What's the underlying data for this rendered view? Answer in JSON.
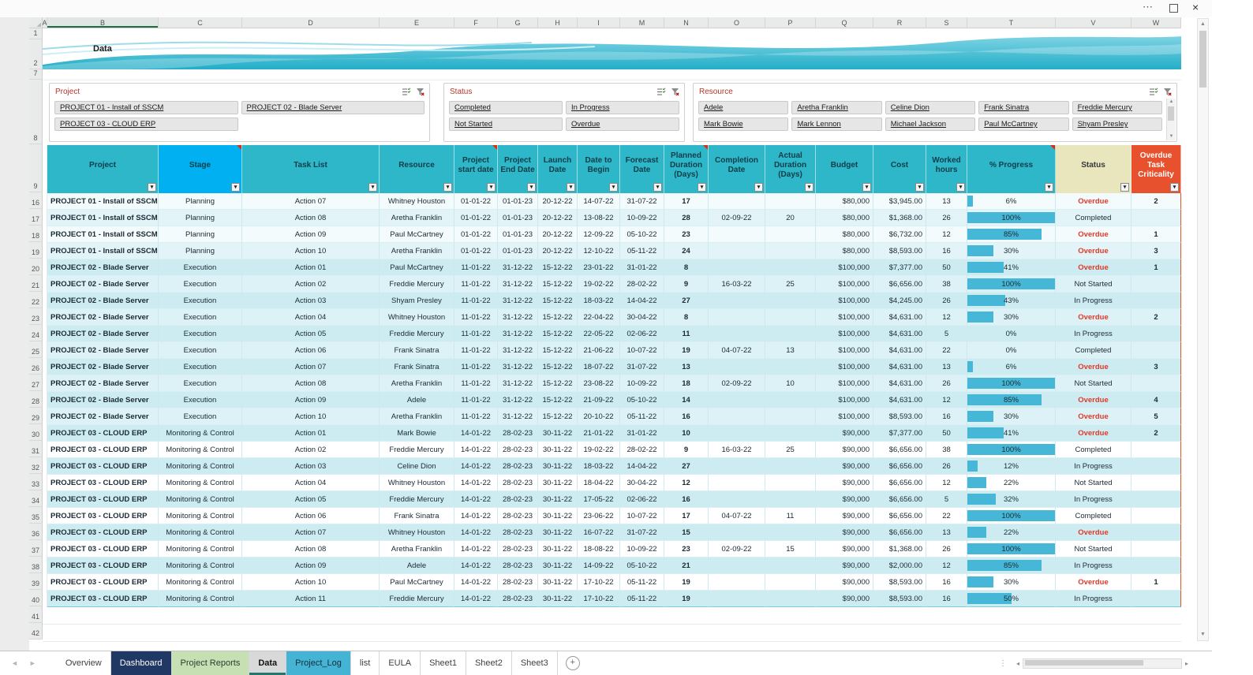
{
  "window": {
    "menu_icon": "⋯",
    "close_icon": "×"
  },
  "icons": {
    "filter_dropdown": "▾",
    "scroll_up": "▲",
    "scroll_down": "▼",
    "left_arrow": "◄",
    "right_arrow": "►",
    "hscroll_left": "◂",
    "hscroll_right": "▸",
    "new_sheet": "+",
    "select_all": "◢",
    "handle": "⋮"
  },
  "banner": {
    "label": "Data"
  },
  "grid": {
    "columns": [
      "A",
      "B",
      "C",
      "D",
      "E",
      "F",
      "G",
      "H",
      "I",
      "M",
      "N",
      "O",
      "P",
      "Q",
      "R",
      "S",
      "T",
      "V",
      "W"
    ],
    "leading_rows": [
      "1",
      "2",
      "7",
      "8",
      "9"
    ],
    "trailing_rows": [
      "41",
      "42"
    ],
    "selected_column": "B"
  },
  "slicers": [
    {
      "title": "Project",
      "columns": 2,
      "items": [
        "PROJECT 01 - Install of SSCM",
        "PROJECT 02 - Blade Server",
        "PROJECT 03 - CLOUD ERP"
      ]
    },
    {
      "title": "Status",
      "columns": 2,
      "items": [
        "Completed",
        "In Progress",
        "Not Started",
        "Overdue"
      ]
    },
    {
      "title": "Resource",
      "columns": 5,
      "scrollbar": true,
      "items": [
        "Adele",
        "Aretha Franklin",
        "Celine Dion",
        "Frank Sinatra",
        "Freddie Mercury",
        "Mark Bowie",
        "Mark Lennon",
        "Michael Jackson",
        "Paul McCartney",
        "Shyam Presley"
      ]
    }
  ],
  "table": {
    "headers": [
      {
        "label": "Project",
        "bg": "#2eb6c9",
        "fg": "#0f3d48"
      },
      {
        "label": "Stage",
        "bg": "#00b0f0",
        "fg": "#0f3d48",
        "note": true
      },
      {
        "label": "Task List",
        "bg": "#2eb6c9",
        "fg": "#0f3d48"
      },
      {
        "label": "Resource",
        "bg": "#2eb6c9",
        "fg": "#0f3d48"
      },
      {
        "label": "Project start date",
        "bg": "#2eb6c9",
        "fg": "#0f3d48",
        "note": true
      },
      {
        "label": "Project End Date",
        "bg": "#2eb6c9",
        "fg": "#0f3d48"
      },
      {
        "label": "Launch Date",
        "bg": "#2eb6c9",
        "fg": "#0f3d48"
      },
      {
        "label": "Date to Begin",
        "bg": "#2eb6c9",
        "fg": "#0f3d48"
      },
      {
        "label": "Forecast Date",
        "bg": "#2eb6c9",
        "fg": "#0f3d48"
      },
      {
        "label": "Planned Duration (Days)",
        "bg": "#2eb6c9",
        "fg": "#0f3d48",
        "note": true
      },
      {
        "label": "Completion Date",
        "bg": "#2eb6c9",
        "fg": "#0f3d48"
      },
      {
        "label": "Actual Duration (Days)",
        "bg": "#2eb6c9",
        "fg": "#0f3d48"
      },
      {
        "label": "Budget",
        "bg": "#2eb6c9",
        "fg": "#0f3d48"
      },
      {
        "label": "Cost",
        "bg": "#2eb6c9",
        "fg": "#0f3d48"
      },
      {
        "label": "Worked hours",
        "bg": "#2eb6c9",
        "fg": "#0f3d48"
      },
      {
        "label": "% Progress",
        "bg": "#2eb6c9",
        "fg": "#0f3d48",
        "note": true
      },
      {
        "label": "Status",
        "bg": "#e9e5bd",
        "fg": "#33393a"
      },
      {
        "label": "Overdue Task Criticality",
        "bg": "#e8512e",
        "fg": "#ffffff"
      }
    ],
    "rows": [
      {
        "n": "16",
        "cells": [
          "PROJECT 01 - Install of SSCM",
          "Planning",
          "Action 07",
          "Whitney Houston",
          "01-01-22",
          "01-01-23",
          "20-12-22",
          "14-07-22",
          "31-07-22",
          "17",
          "",
          "",
          "$80,000",
          "$3,945.00",
          "13",
          "6%",
          "Overdue",
          "2"
        ]
      },
      {
        "n": "17",
        "cells": [
          "PROJECT 01 - Install of SSCM",
          "Planning",
          "Action 08",
          "Aretha Franklin",
          "01-01-22",
          "01-01-23",
          "20-12-22",
          "13-08-22",
          "10-09-22",
          "28",
          "02-09-22",
          "20",
          "$80,000",
          "$1,368.00",
          "26",
          "100%",
          "Completed",
          ""
        ]
      },
      {
        "n": "18",
        "cells": [
          "PROJECT 01 - Install of SSCM",
          "Planning",
          "Action 09",
          "Paul McCartney",
          "01-01-22",
          "01-01-23",
          "20-12-22",
          "12-09-22",
          "05-10-22",
          "23",
          "",
          "",
          "$80,000",
          "$6,732.00",
          "12",
          "85%",
          "Overdue",
          "1"
        ]
      },
      {
        "n": "19",
        "cells": [
          "PROJECT 01 - Install of SSCM",
          "Planning",
          "Action 10",
          "Aretha Franklin",
          "01-01-22",
          "01-01-23",
          "20-12-22",
          "12-10-22",
          "05-11-22",
          "24",
          "",
          "",
          "$80,000",
          "$8,593.00",
          "16",
          "30%",
          "Overdue",
          "3"
        ]
      },
      {
        "n": "20",
        "cells": [
          "PROJECT 02 - Blade Server",
          "Execution",
          "Action 01",
          "Paul McCartney",
          "11-01-22",
          "31-12-22",
          "15-12-22",
          "23-01-22",
          "31-01-22",
          "8",
          "",
          "",
          "$100,000",
          "$7,377.00",
          "50",
          "41%",
          "Overdue",
          "1"
        ]
      },
      {
        "n": "21",
        "cells": [
          "PROJECT 02 - Blade Server",
          "Execution",
          "Action 02",
          "Freddie Mercury",
          "11-01-22",
          "31-12-22",
          "15-12-22",
          "19-02-22",
          "28-02-22",
          "9",
          "16-03-22",
          "25",
          "$100,000",
          "$6,656.00",
          "38",
          "100%",
          "Not Started",
          ""
        ]
      },
      {
        "n": "22",
        "cells": [
          "PROJECT 02 - Blade Server",
          "Execution",
          "Action 03",
          "Shyam Presley",
          "11-01-22",
          "31-12-22",
          "15-12-22",
          "18-03-22",
          "14-04-22",
          "27",
          "",
          "",
          "$100,000",
          "$4,245.00",
          "26",
          "43%",
          "In Progress",
          ""
        ]
      },
      {
        "n": "23",
        "cells": [
          "PROJECT 02 - Blade Server",
          "Execution",
          "Action 04",
          "Whitney Houston",
          "11-01-22",
          "31-12-22",
          "15-12-22",
          "22-04-22",
          "30-04-22",
          "8",
          "",
          "",
          "$100,000",
          "$4,631.00",
          "12",
          "30%",
          "Overdue",
          "2"
        ]
      },
      {
        "n": "24",
        "cells": [
          "PROJECT 02 - Blade Server",
          "Execution",
          "Action 05",
          "Freddie Mercury",
          "11-01-22",
          "31-12-22",
          "15-12-22",
          "22-05-22",
          "02-06-22",
          "11",
          "",
          "",
          "$100,000",
          "$4,631.00",
          "5",
          "0%",
          "In Progress",
          ""
        ]
      },
      {
        "n": "25",
        "cells": [
          "PROJECT 02 - Blade Server",
          "Execution",
          "Action 06",
          "Frank Sinatra",
          "11-01-22",
          "31-12-22",
          "15-12-22",
          "21-06-22",
          "10-07-22",
          "19",
          "04-07-22",
          "13",
          "$100,000",
          "$4,631.00",
          "22",
          "0%",
          "Completed",
          ""
        ]
      },
      {
        "n": "26",
        "cells": [
          "PROJECT 02 - Blade Server",
          "Execution",
          "Action 07",
          "Frank Sinatra",
          "11-01-22",
          "31-12-22",
          "15-12-22",
          "18-07-22",
          "31-07-22",
          "13",
          "",
          "",
          "$100,000",
          "$4,631.00",
          "13",
          "6%",
          "Overdue",
          "3"
        ]
      },
      {
        "n": "27",
        "cells": [
          "PROJECT 02 - Blade Server",
          "Execution",
          "Action 08",
          "Aretha Franklin",
          "11-01-22",
          "31-12-22",
          "15-12-22",
          "23-08-22",
          "10-09-22",
          "18",
          "02-09-22",
          "10",
          "$100,000",
          "$4,631.00",
          "26",
          "100%",
          "Not Started",
          ""
        ]
      },
      {
        "n": "28",
        "cells": [
          "PROJECT 02 - Blade Server",
          "Execution",
          "Action 09",
          "Adele",
          "11-01-22",
          "31-12-22",
          "15-12-22",
          "21-09-22",
          "05-10-22",
          "14",
          "",
          "",
          "$100,000",
          "$4,631.00",
          "12",
          "85%",
          "Overdue",
          "4"
        ]
      },
      {
        "n": "29",
        "cells": [
          "PROJECT 02 - Blade Server",
          "Execution",
          "Action 10",
          "Aretha Franklin",
          "11-01-22",
          "31-12-22",
          "15-12-22",
          "20-10-22",
          "05-11-22",
          "16",
          "",
          "",
          "$100,000",
          "$8,593.00",
          "16",
          "30%",
          "Overdue",
          "5"
        ]
      },
      {
        "n": "30",
        "cells": [
          "PROJECT 03 - CLOUD ERP",
          "Monitoring & Control",
          "Action 01",
          "Mark Bowie",
          "14-01-22",
          "28-02-23",
          "30-11-22",
          "21-01-22",
          "31-01-22",
          "10",
          "",
          "",
          "$90,000",
          "$7,377.00",
          "50",
          "41%",
          "Overdue",
          "2"
        ]
      },
      {
        "n": "31",
        "cells": [
          "PROJECT 03 - CLOUD ERP",
          "Monitoring & Control",
          "Action 02",
          "Freddie Mercury",
          "14-01-22",
          "28-02-23",
          "30-11-22",
          "19-02-22",
          "28-02-22",
          "9",
          "16-03-22",
          "25",
          "$90,000",
          "$6,656.00",
          "38",
          "100%",
          "Completed",
          ""
        ]
      },
      {
        "n": "32",
        "cells": [
          "PROJECT 03 - CLOUD ERP",
          "Monitoring & Control",
          "Action 03",
          "Celine Dion",
          "14-01-22",
          "28-02-23",
          "30-11-22",
          "18-03-22",
          "14-04-22",
          "27",
          "",
          "",
          "$90,000",
          "$6,656.00",
          "26",
          "12%",
          "In Progress",
          ""
        ]
      },
      {
        "n": "33",
        "cells": [
          "PROJECT 03 - CLOUD ERP",
          "Monitoring & Control",
          "Action 04",
          "Whitney Houston",
          "14-01-22",
          "28-02-23",
          "30-11-22",
          "18-04-22",
          "30-04-22",
          "12",
          "",
          "",
          "$90,000",
          "$6,656.00",
          "12",
          "22%",
          "Not Started",
          ""
        ]
      },
      {
        "n": "34",
        "cells": [
          "PROJECT 03 - CLOUD ERP",
          "Monitoring & Control",
          "Action 05",
          "Freddie Mercury",
          "14-01-22",
          "28-02-23",
          "30-11-22",
          "17-05-22",
          "02-06-22",
          "16",
          "",
          "",
          "$90,000",
          "$6,656.00",
          "5",
          "32%",
          "In Progress",
          ""
        ]
      },
      {
        "n": "35",
        "cells": [
          "PROJECT 03 - CLOUD ERP",
          "Monitoring & Control",
          "Action 06",
          "Frank Sinatra",
          "14-01-22",
          "28-02-23",
          "30-11-22",
          "23-06-22",
          "10-07-22",
          "17",
          "04-07-22",
          "11",
          "$90,000",
          "$6,656.00",
          "22",
          "100%",
          "Completed",
          ""
        ]
      },
      {
        "n": "36",
        "cells": [
          "PROJECT 03 - CLOUD ERP",
          "Monitoring & Control",
          "Action 07",
          "Whitney Houston",
          "14-01-22",
          "28-02-23",
          "30-11-22",
          "16-07-22",
          "31-07-22",
          "15",
          "",
          "",
          "$90,000",
          "$6,656.00",
          "13",
          "22%",
          "Overdue",
          ""
        ]
      },
      {
        "n": "37",
        "cells": [
          "PROJECT 03 - CLOUD ERP",
          "Monitoring & Control",
          "Action 08",
          "Aretha Franklin",
          "14-01-22",
          "28-02-23",
          "30-11-22",
          "18-08-22",
          "10-09-22",
          "23",
          "02-09-22",
          "15",
          "$90,000",
          "$1,368.00",
          "26",
          "100%",
          "Not Started",
          ""
        ]
      },
      {
        "n": "38",
        "cells": [
          "PROJECT 03 - CLOUD ERP",
          "Monitoring & Control",
          "Action 09",
          "Adele",
          "14-01-22",
          "28-02-23",
          "30-11-22",
          "14-09-22",
          "05-10-22",
          "21",
          "",
          "",
          "$90,000",
          "$2,000.00",
          "12",
          "85%",
          "In Progress",
          ""
        ]
      },
      {
        "n": "39",
        "cells": [
          "PROJECT 03 - CLOUD ERP",
          "Monitoring & Control",
          "Action 10",
          "Paul McCartney",
          "14-01-22",
          "28-02-23",
          "30-11-22",
          "17-10-22",
          "05-11-22",
          "19",
          "",
          "",
          "$90,000",
          "$8,593.00",
          "16",
          "30%",
          "Overdue",
          "1"
        ]
      },
      {
        "n": "40",
        "cells": [
          "PROJECT 03 - CLOUD ERP",
          "Monitoring & Control",
          "Action 11",
          "Freddie Mercury",
          "14-01-22",
          "28-02-23",
          "30-11-22",
          "17-10-22",
          "05-11-22",
          "19",
          "",
          "",
          "$90,000",
          "$8,593.00",
          "16",
          "50%",
          "In Progress",
          ""
        ]
      }
    ]
  },
  "tabs": {
    "items": [
      {
        "label": "Overview",
        "bg": "",
        "fg": "#3f3f3f"
      },
      {
        "label": "Dashboard",
        "bg": "#1f3864",
        "fg": "#ffffff"
      },
      {
        "label": "Project Reports",
        "bg": "#c6e0b4",
        "fg": "#2e3b2e"
      },
      {
        "label": "Data",
        "bg": "#d9d9d9",
        "fg": "#111111",
        "active": true,
        "accent": "#1f7a6d"
      },
      {
        "label": "Project_Log",
        "bg": "#44b3d4",
        "fg": "#12303b"
      },
      {
        "label": "list",
        "bg": "",
        "fg": "#3f3f3f"
      },
      {
        "label": "EULA",
        "bg": "",
        "fg": "#3f3f3f"
      },
      {
        "label": "Sheet1",
        "bg": "",
        "fg": "#3f3f3f"
      },
      {
        "label": "Sheet2",
        "bg": "",
        "fg": "#3f3f3f"
      },
      {
        "label": "Sheet3",
        "bg": "",
        "fg": "#3f3f3f"
      }
    ]
  },
  "colors": {
    "header_cyan": "#2eb6c9",
    "stage_blue": "#00b0f0",
    "status_yellow": "#e9e5bd",
    "criticality_red": "#e8512e",
    "overdue_text": "#e23a28",
    "progress_bar": "#47b7d7",
    "slicer_title": "#b5372b",
    "stripes": {
      "p1": [
        "#f3fbfc",
        "#e2f4f8"
      ],
      "p2": [
        "#cdecf2",
        "#ddf2f6"
      ],
      "p3": [
        "#cdecf2",
        "#ffffff"
      ]
    }
  }
}
